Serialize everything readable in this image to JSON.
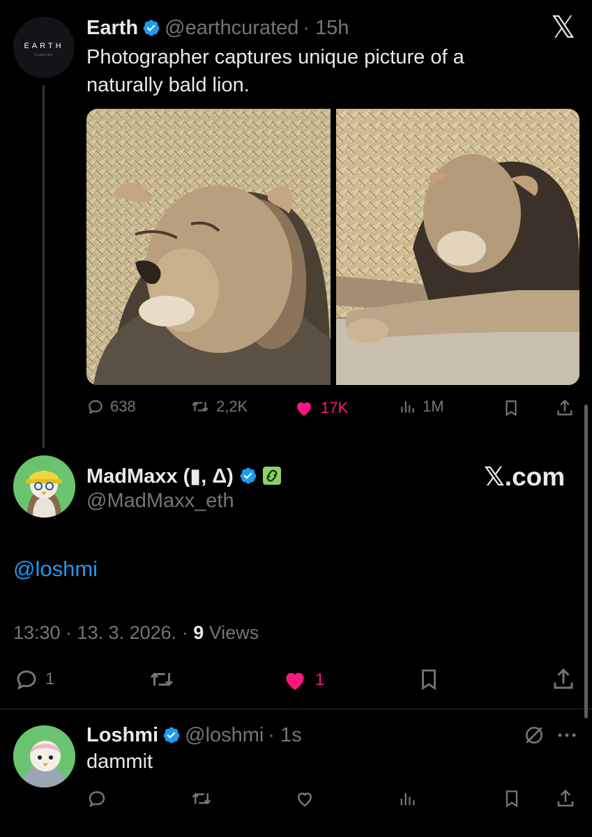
{
  "quoted": {
    "avatar_text": "EARTH",
    "avatar_sub": "CURATED",
    "name": "Earth",
    "handle": "@earthcurated",
    "time": "· 15h",
    "text_line1": "Photographer captures unique picture of a",
    "text_line2": "naturally bald lion.",
    "stats": {
      "replies": "638",
      "reposts": "2,2K",
      "likes": "17K",
      "views": "1M"
    }
  },
  "top_logo": "𝕏",
  "main": {
    "name": "MadMaxx (▮, Δ)",
    "handle": "@MadMaxx_eth",
    "brand": "𝕏.com",
    "mention": "@loshmi",
    "timestamp": "13:30 · 13. 3. 2026. · ",
    "views_count": "9",
    "views_label": " Views",
    "stats": {
      "replies": "1",
      "likes": "1"
    }
  },
  "reply": {
    "name": "Loshmi",
    "handle": "@loshmi",
    "time": "· 1s",
    "text": "dammit"
  },
  "colors": {
    "accent": "#1d9bf0",
    "like": "#f91880",
    "muted": "#71767b",
    "bg": "#000000"
  }
}
